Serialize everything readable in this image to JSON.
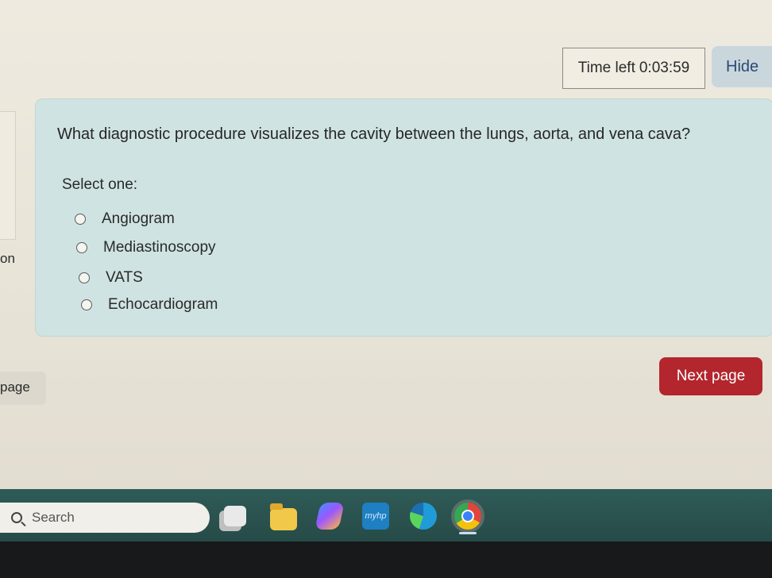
{
  "timer": {
    "label": "Time left",
    "value": "0:03:59"
  },
  "hide_button": {
    "label": "Hide"
  },
  "question": {
    "text": "What diagnostic procedure visualizes the cavity between the lungs, aorta, and vena cava?",
    "select_label": "Select one:",
    "options": [
      {
        "label": "Angiogram"
      },
      {
        "label": "Mediastinoscopy"
      },
      {
        "label": "VATS"
      },
      {
        "label": "Echocardiogram"
      }
    ]
  },
  "left_fragments": {
    "frag1": "on",
    "frag2": "page"
  },
  "next_button": {
    "label": "Next page"
  },
  "colors": {
    "accent": "#b3262d",
    "question_bg": "#cfe3e2",
    "hide_text": "#2a4a73"
  },
  "taskbar": {
    "search_label": "Search",
    "icons": [
      {
        "name": "task-view-icon"
      },
      {
        "name": "file-explorer-icon"
      },
      {
        "name": "copilot-icon"
      },
      {
        "name": "myhp-icon",
        "label": "myhp"
      },
      {
        "name": "edge-icon"
      },
      {
        "name": "chrome-icon"
      }
    ]
  }
}
